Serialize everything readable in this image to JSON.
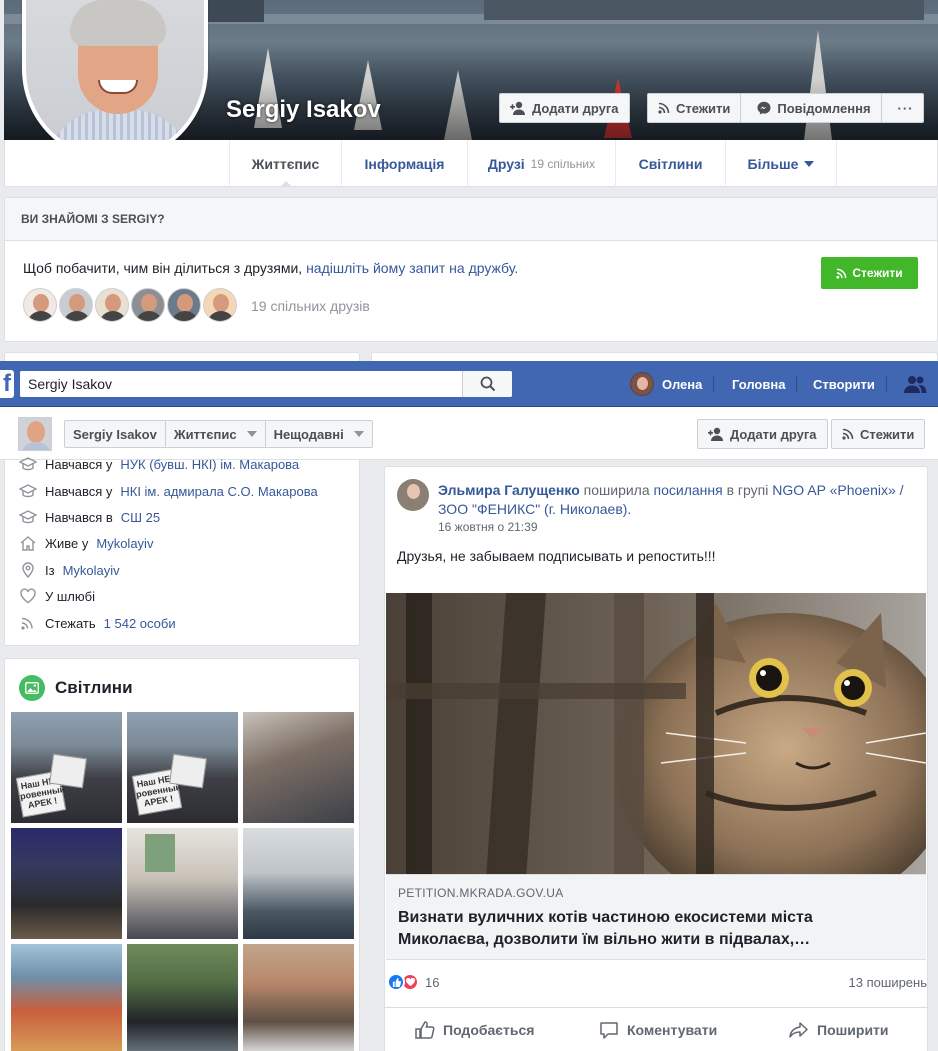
{
  "profile": {
    "name": "Sergiy Isakov",
    "add_friend_label": "Додати друга",
    "follow_label": "Стежити",
    "message_label": "Повідомлення",
    "more_label": "···"
  },
  "timeline_tabs": [
    {
      "label": "Життєпис",
      "sub": ""
    },
    {
      "label": "Інформація",
      "sub": ""
    },
    {
      "label": "Друзі",
      "sub": "19 спільних"
    },
    {
      "label": "Світлини",
      "sub": ""
    },
    {
      "label": "Більше",
      "sub": ""
    }
  ],
  "know": {
    "heading": "ВИ ЗНАЙОМІ З SERGIY?",
    "text": "Щоб побачити, чим він ділиться з друзями,",
    "link": "надішліть йому запит на дружбу.",
    "follow_button": "Стежити",
    "mutual": "19 спільних друзів"
  },
  "topbar": {
    "logo": "f",
    "search_value": "Sergiy Isakov",
    "user_name": "Олена",
    "home": "Головна",
    "create": "Створити"
  },
  "sticky": {
    "crumbs": [
      "Sergiy Isakov",
      "Життєпис",
      "Нещодавні"
    ],
    "add_friend": "Додати друга",
    "follow": "Стежити"
  },
  "intro": [
    {
      "text": "Навчався у",
      "link": "НУК (бувш. НКІ) ім. Макарова",
      "icon": "education-icon"
    },
    {
      "text": "Навчався у",
      "link": "НКІ ім. адмирала С.О. Макарова",
      "icon": "education-icon"
    },
    {
      "text": "Навчався в",
      "link": "СШ 25",
      "icon": "education-icon"
    },
    {
      "text": "Живе у",
      "link": "Mykolayiv",
      "icon": "home-icon"
    },
    {
      "text": "Із",
      "link": "Mykolayiv",
      "icon": "location-pin-icon"
    },
    {
      "text": "У шлюбі",
      "link": "",
      "icon": "heart-icon"
    },
    {
      "text": "Стежать",
      "link": "1 542 особи",
      "icon": "rss-icon"
    }
  ],
  "photos": {
    "title": "Світлини",
    "sign_text": "Наш НЕ- ровенный АРЕК !"
  },
  "post": {
    "author": "Эльмира Галущенко",
    "action": "поширила",
    "link_word": "посилання",
    "in_group": "в групі",
    "group": "NGO AP «Phoenix» / ЗОО \"ФЕНИКС\" (г. Николаев).",
    "time": "16 жовтня о 21:39",
    "text": "Друзья, не забываем подписывать и репостить!!!",
    "link_domain": "PETITION.MKRADA.GOV.UA",
    "link_title": "Визнати вуличних котів частиною екосистеми міста Миколаєва, дозволити їм вільно жити в підвалах,…",
    "reaction_count": "16",
    "shares": "13 поширень",
    "like": "Подобається",
    "comment": "Коментувати",
    "share": "Поширити"
  },
  "colors": {
    "fb_blue": "#4267b2",
    "link": "#365899",
    "green": "#42b72a"
  }
}
